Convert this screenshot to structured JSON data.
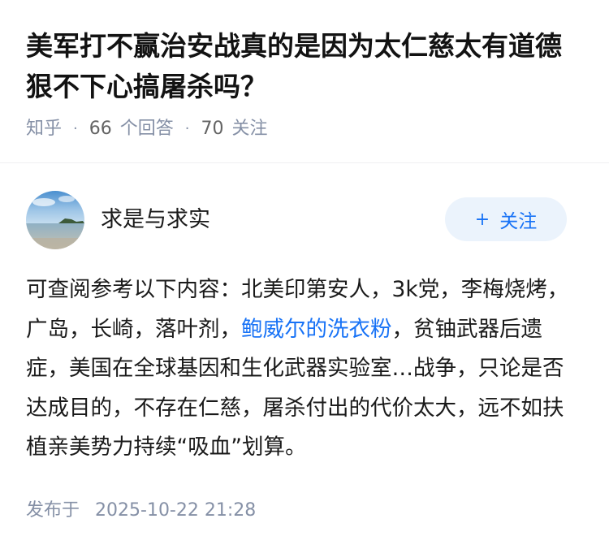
{
  "question": {
    "title": "美军打不赢治安战真的是因为太仁慈太有道德狠不下心搞屠杀吗？",
    "source": "知乎",
    "separator": "·",
    "answers_count": "66",
    "answers_label": "个回答",
    "followers_count": "70",
    "followers_label": "关注"
  },
  "answer": {
    "author_name": "求是与求实",
    "follow_button": {
      "plus": "+",
      "label": "关注"
    },
    "body": {
      "part1": "可查阅参考以下内容：北美印第安人，3k党，李梅烧烤，广岛，长崎，落叶剂，",
      "link": "鲍威尔的洗衣粉",
      "part2": "，贫铀武器后遗症，美国在全球基因和生化武器实验室…战争，只论是否达成目的，不存在仁慈，屠杀付出的代价太大，远不如扶植亲美势力持续“吸血”划算。"
    },
    "publish_label": "发布于",
    "publish_time": "2025-10-22 21:28"
  },
  "colors": {
    "link": "#1772f6",
    "meta": "#8590a6",
    "follow_bg": "#ebf3fc"
  },
  "icons": {
    "avatar": "beach-avatar-icon"
  }
}
